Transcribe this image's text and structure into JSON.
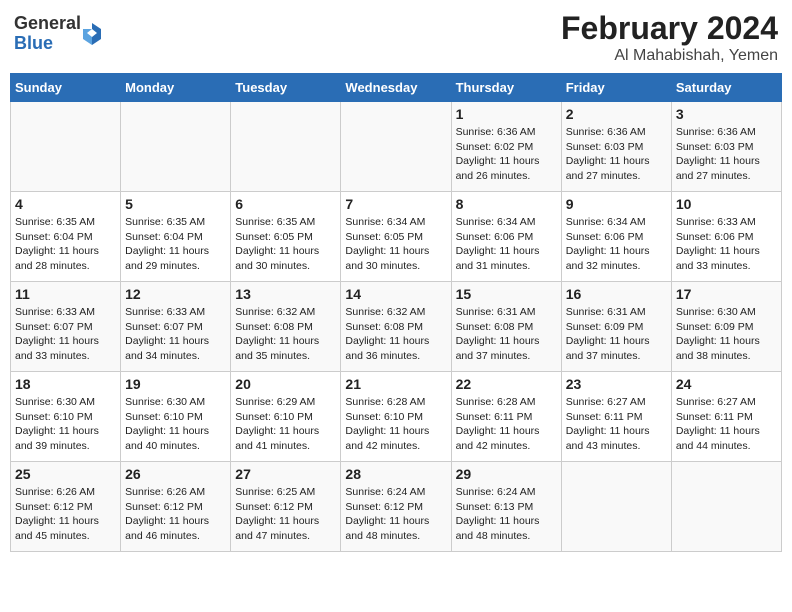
{
  "header": {
    "logo_general": "General",
    "logo_blue": "Blue",
    "title": "February 2024",
    "location": "Al Mahabishah, Yemen"
  },
  "days_of_week": [
    "Sunday",
    "Monday",
    "Tuesday",
    "Wednesday",
    "Thursday",
    "Friday",
    "Saturday"
  ],
  "weeks": [
    [
      {
        "day": "",
        "info": ""
      },
      {
        "day": "",
        "info": ""
      },
      {
        "day": "",
        "info": ""
      },
      {
        "day": "",
        "info": ""
      },
      {
        "day": "1",
        "info": "Sunrise: 6:36 AM\nSunset: 6:02 PM\nDaylight: 11 hours and 26 minutes."
      },
      {
        "day": "2",
        "info": "Sunrise: 6:36 AM\nSunset: 6:03 PM\nDaylight: 11 hours and 27 minutes."
      },
      {
        "day": "3",
        "info": "Sunrise: 6:36 AM\nSunset: 6:03 PM\nDaylight: 11 hours and 27 minutes."
      }
    ],
    [
      {
        "day": "4",
        "info": "Sunrise: 6:35 AM\nSunset: 6:04 PM\nDaylight: 11 hours and 28 minutes."
      },
      {
        "day": "5",
        "info": "Sunrise: 6:35 AM\nSunset: 6:04 PM\nDaylight: 11 hours and 29 minutes."
      },
      {
        "day": "6",
        "info": "Sunrise: 6:35 AM\nSunset: 6:05 PM\nDaylight: 11 hours and 30 minutes."
      },
      {
        "day": "7",
        "info": "Sunrise: 6:34 AM\nSunset: 6:05 PM\nDaylight: 11 hours and 30 minutes."
      },
      {
        "day": "8",
        "info": "Sunrise: 6:34 AM\nSunset: 6:06 PM\nDaylight: 11 hours and 31 minutes."
      },
      {
        "day": "9",
        "info": "Sunrise: 6:34 AM\nSunset: 6:06 PM\nDaylight: 11 hours and 32 minutes."
      },
      {
        "day": "10",
        "info": "Sunrise: 6:33 AM\nSunset: 6:06 PM\nDaylight: 11 hours and 33 minutes."
      }
    ],
    [
      {
        "day": "11",
        "info": "Sunrise: 6:33 AM\nSunset: 6:07 PM\nDaylight: 11 hours and 33 minutes."
      },
      {
        "day": "12",
        "info": "Sunrise: 6:33 AM\nSunset: 6:07 PM\nDaylight: 11 hours and 34 minutes."
      },
      {
        "day": "13",
        "info": "Sunrise: 6:32 AM\nSunset: 6:08 PM\nDaylight: 11 hours and 35 minutes."
      },
      {
        "day": "14",
        "info": "Sunrise: 6:32 AM\nSunset: 6:08 PM\nDaylight: 11 hours and 36 minutes."
      },
      {
        "day": "15",
        "info": "Sunrise: 6:31 AM\nSunset: 6:08 PM\nDaylight: 11 hours and 37 minutes."
      },
      {
        "day": "16",
        "info": "Sunrise: 6:31 AM\nSunset: 6:09 PM\nDaylight: 11 hours and 37 minutes."
      },
      {
        "day": "17",
        "info": "Sunrise: 6:30 AM\nSunset: 6:09 PM\nDaylight: 11 hours and 38 minutes."
      }
    ],
    [
      {
        "day": "18",
        "info": "Sunrise: 6:30 AM\nSunset: 6:10 PM\nDaylight: 11 hours and 39 minutes."
      },
      {
        "day": "19",
        "info": "Sunrise: 6:30 AM\nSunset: 6:10 PM\nDaylight: 11 hours and 40 minutes."
      },
      {
        "day": "20",
        "info": "Sunrise: 6:29 AM\nSunset: 6:10 PM\nDaylight: 11 hours and 41 minutes."
      },
      {
        "day": "21",
        "info": "Sunrise: 6:28 AM\nSunset: 6:10 PM\nDaylight: 11 hours and 42 minutes."
      },
      {
        "day": "22",
        "info": "Sunrise: 6:28 AM\nSunset: 6:11 PM\nDaylight: 11 hours and 42 minutes."
      },
      {
        "day": "23",
        "info": "Sunrise: 6:27 AM\nSunset: 6:11 PM\nDaylight: 11 hours and 43 minutes."
      },
      {
        "day": "24",
        "info": "Sunrise: 6:27 AM\nSunset: 6:11 PM\nDaylight: 11 hours and 44 minutes."
      }
    ],
    [
      {
        "day": "25",
        "info": "Sunrise: 6:26 AM\nSunset: 6:12 PM\nDaylight: 11 hours and 45 minutes."
      },
      {
        "day": "26",
        "info": "Sunrise: 6:26 AM\nSunset: 6:12 PM\nDaylight: 11 hours and 46 minutes."
      },
      {
        "day": "27",
        "info": "Sunrise: 6:25 AM\nSunset: 6:12 PM\nDaylight: 11 hours and 47 minutes."
      },
      {
        "day": "28",
        "info": "Sunrise: 6:24 AM\nSunset: 6:12 PM\nDaylight: 11 hours and 48 minutes."
      },
      {
        "day": "29",
        "info": "Sunrise: 6:24 AM\nSunset: 6:13 PM\nDaylight: 11 hours and 48 minutes."
      },
      {
        "day": "",
        "info": ""
      },
      {
        "day": "",
        "info": ""
      }
    ]
  ]
}
